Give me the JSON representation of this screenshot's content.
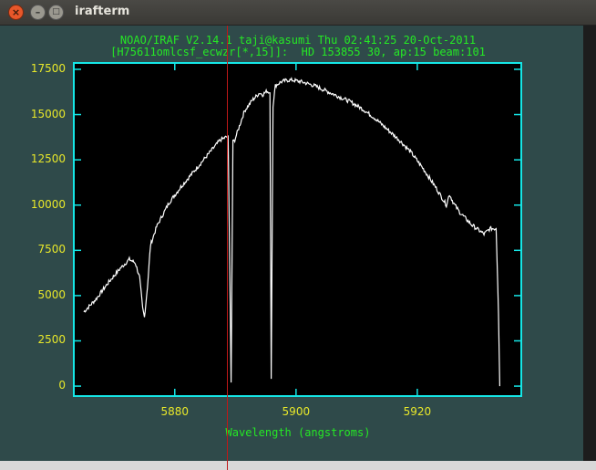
{
  "window": {
    "title": "irafterm",
    "close_icon": "×",
    "min_icon": "–",
    "max_icon": "□"
  },
  "header": {
    "line1": "NOAO/IRAF V2.14.1 taji@kasumi Thu 02:41:25 20-Oct-2011",
    "line2": "[H75611omlcsf_ecwzr[*,15]]:  HD 153855 30, ap:15 beam:101"
  },
  "chart_data": {
    "type": "line",
    "xlabel": "Wavelength (angstroms)",
    "ylabel": "",
    "xlim": [
      5863.5,
      5937
    ],
    "ylim": [
      -500,
      17800
    ],
    "xticks": [
      5880,
      5900,
      5920
    ],
    "xtick_labels": [
      "5880",
      "5900",
      "5920"
    ],
    "yticks": [
      0,
      2500,
      5000,
      7500,
      10000,
      12500,
      15000,
      17500
    ],
    "ytick_labels": [
      "0",
      "2500",
      "5000",
      "7500",
      "10000",
      "12500",
      "15000",
      "17500"
    ],
    "series": [
      {
        "x": [
          5865,
          5867,
          5869,
          5871,
          5872.5,
          5873.5,
          5874.2,
          5874.7,
          5875.0,
          5875.5,
          5876,
          5877,
          5879,
          5881,
          5883,
          5885,
          5886.5,
          5887.5,
          5888.8,
          5889.3,
          5889.6,
          5889.9,
          5890.3,
          5891.5,
          5892.8,
          5893.4,
          5894,
          5894.5,
          5895.2,
          5895.7,
          5895.9,
          5896.2,
          5896.6,
          5897.5,
          5898.5,
          5899.5,
          5901,
          5903,
          5905,
          5907,
          5909,
          5911,
          5913,
          5915,
          5917,
          5919,
          5921,
          5923,
          5924.8,
          5925.3,
          5926,
          5927,
          5929,
          5931,
          5932,
          5933,
          5933.4,
          5933.6
        ],
        "values": [
          4100,
          4800,
          5700,
          6500,
          7000,
          6800,
          6000,
          4300,
          3800,
          5500,
          7800,
          8800,
          10100,
          11000,
          11800,
          12600,
          13200,
          13600,
          13800,
          200,
          13500,
          13600,
          14000,
          15200,
          15800,
          16000,
          16200,
          16100,
          16300,
          16200,
          400,
          15500,
          16600,
          16800,
          16900,
          16900,
          16800,
          16600,
          16300,
          16000,
          15700,
          15300,
          14800,
          14200,
          13600,
          12900,
          12000,
          11000,
          10000,
          10600,
          10100,
          9600,
          8900,
          8400,
          8700,
          8700,
          4000,
          0
        ]
      }
    ]
  }
}
